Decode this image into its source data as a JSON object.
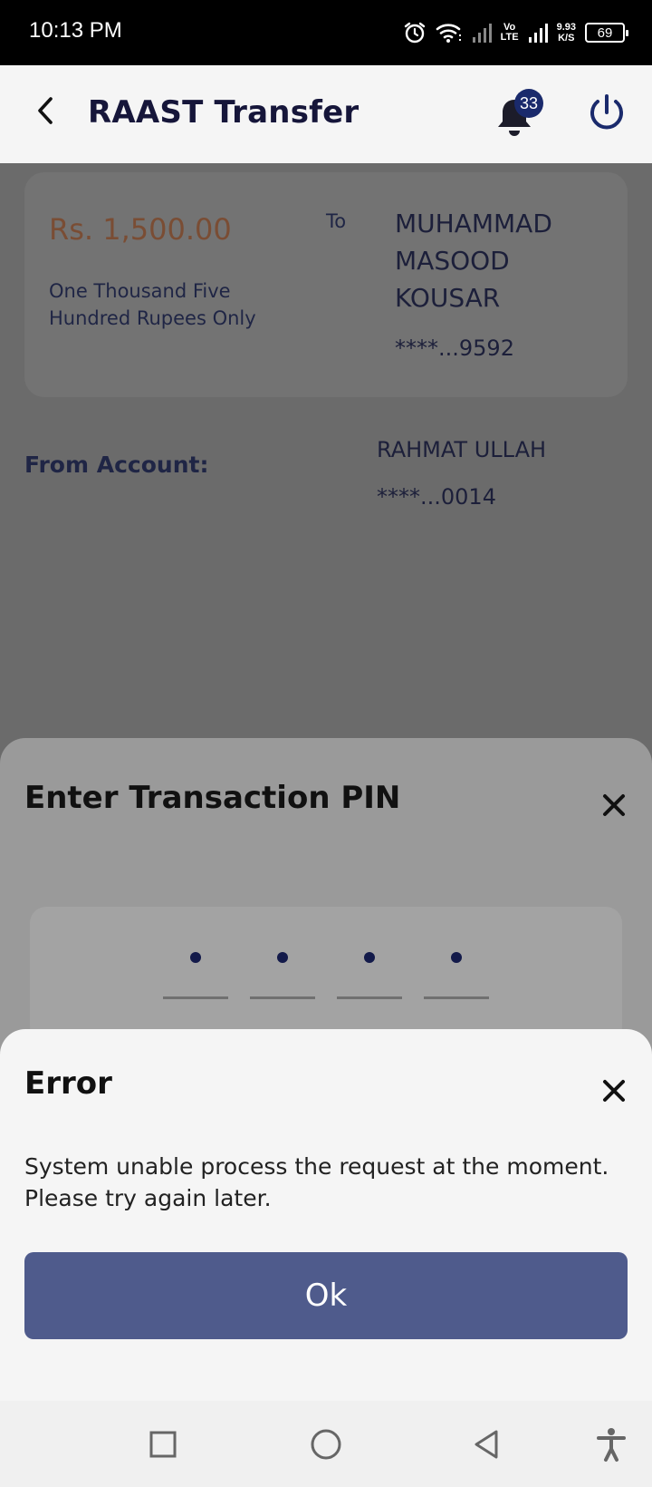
{
  "status_bar": {
    "time": "10:13 PM",
    "network_speed_value": "9.93",
    "network_speed_unit": "K/S",
    "volte_top": "Vo",
    "volte_bottom": "LTE",
    "battery": "69",
    "icons": [
      "alarm-icon",
      "wifi-icon",
      "signal-icon",
      "signal-icon"
    ]
  },
  "header": {
    "title": "RAAST Transfer",
    "notification_count": "33",
    "icons": [
      "back-arrow-icon",
      "bell-icon",
      "power-icon"
    ]
  },
  "transfer": {
    "amount": "Rs. 1,500.00",
    "amount_words": "One Thousand Five Hundred Rupees Only",
    "to_label": "To",
    "recipient_name": "MUHAMMAD MASOOD KOUSAR",
    "recipient_account": "****...9592",
    "from_label": "From Account:",
    "from_name": "RAHMAT ULLAH",
    "from_account": "****...0014"
  },
  "pin_sheet": {
    "title": "Enter Transaction PIN",
    "digits_entered": 4,
    "digits_total": 4
  },
  "error_dialog": {
    "title": "Error",
    "message": "System unable process the request at the moment. Please try again later.",
    "ok_label": "Ok"
  },
  "nav_bar": {
    "icons": [
      "recents-square-icon",
      "home-circle-icon",
      "back-triangle-icon",
      "accessibility-icon"
    ]
  },
  "colors": {
    "accent": "#4f5b8c",
    "navy": "#1a2a6c",
    "amount": "#7a4d34"
  }
}
